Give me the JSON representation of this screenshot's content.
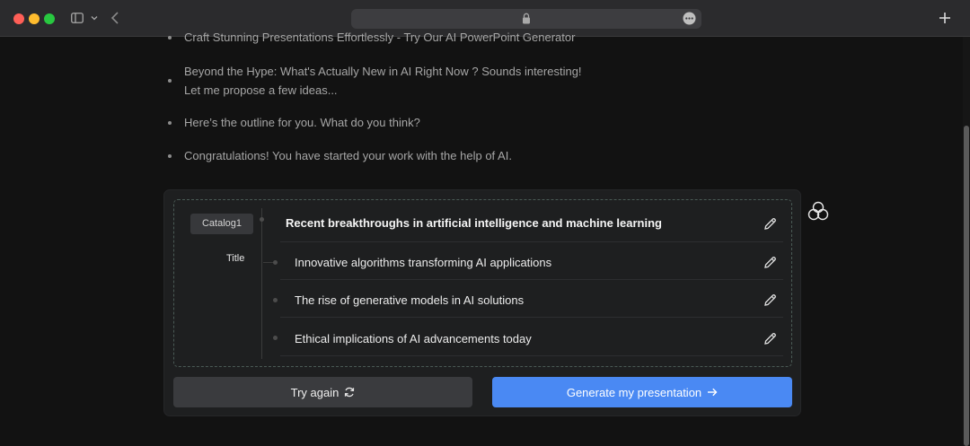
{
  "messages": [
    {
      "text": "Craft Stunning Presentations Effortlessly - Try Our AI PowerPoint Generator"
    },
    {
      "text": "Beyond the Hype: What's Actually New in AI Right Now ? Sounds interesting!"
    },
    {
      "text": "Let me propose a few ideas..."
    },
    {
      "text": "Here’s the outline for you. What do you think?"
    },
    {
      "text": "Congratulations! You have started your work with the help of AI."
    }
  ],
  "outline": {
    "catalog_label": "Catalog1",
    "title_label": "Title",
    "title": "Recent breakthroughs in artificial intelligence and machine learning",
    "items": [
      {
        "text": "Innovative algorithms transforming AI applications"
      },
      {
        "text": "The rise of generative models in AI solutions"
      },
      {
        "text": "Ethical implications of AI advancements today"
      }
    ]
  },
  "actions": {
    "try_again_label": "Try again",
    "generate_label": "Generate my presentation"
  },
  "icons": {
    "lock": "lock-icon",
    "more": "more-icon",
    "edit": "pencil-icon",
    "refresh": "refresh-icon",
    "arrow": "arrow-right-icon",
    "side_action": "circles-icon"
  },
  "colors": {
    "accent": "#4a89f3",
    "background": "#121212",
    "card": "#1e1f20"
  }
}
